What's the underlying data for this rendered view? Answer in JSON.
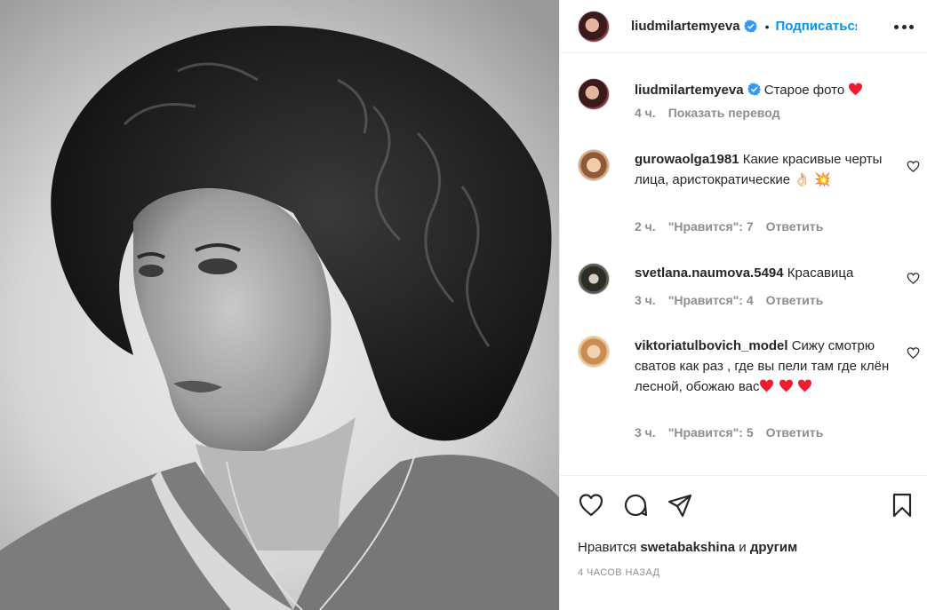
{
  "post": {
    "username": "liudmilartemyeva",
    "follow_label": "Подписаться",
    "dot": "•"
  },
  "caption": {
    "username": "liudmilartemyeva",
    "text": "Старое фото",
    "time": "4 ч.",
    "translate": "Показать перевод"
  },
  "comments": [
    {
      "username": "gurowaolga1981",
      "text": "Какие красивые черты лица, аристократические",
      "emojis": "👌🏻 💥",
      "time": "2 ч.",
      "likes": "\"Нравится\": 7",
      "reply": "Ответить"
    },
    {
      "username": "svetlana.naumova.5494",
      "text": "Красавица",
      "time": "3 ч.",
      "likes": "\"Нравится\": 4",
      "reply": "Ответить"
    },
    {
      "username": "viktoriatulbovich_model",
      "text": "Сижу смотрю сватов как раз , где вы пели там где клён лесной, обожаю вас",
      "time": "3 ч.",
      "likes": "\"Нравится\": 5",
      "reply": "Ответить"
    }
  ],
  "footer": {
    "likes_prefix": "Нравится",
    "likes_user": "swetabakshina",
    "likes_and": "и",
    "likes_others": "другим",
    "time": "4 ЧАСОВ НАЗАД"
  },
  "icons": {
    "like": "heart-icon",
    "comment": "comment-icon",
    "share": "share-icon",
    "save": "bookmark-icon",
    "more": "more-icon",
    "verified": "verified-badge-icon"
  },
  "colors": {
    "accent": "#0095f6",
    "verified": "#3897f0",
    "heart_red": "#ed1c2e",
    "meta": "#8e8e8e"
  }
}
